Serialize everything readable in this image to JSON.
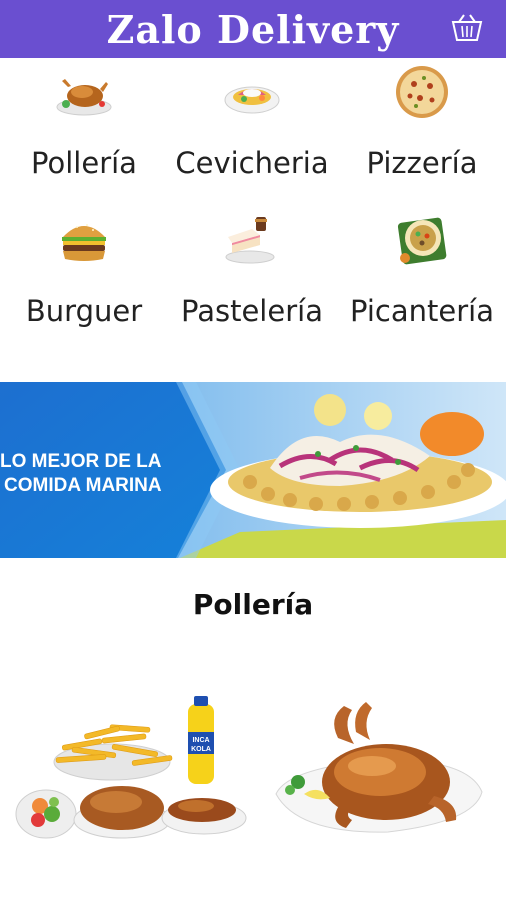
{
  "header": {
    "title": "Zalo Delivery",
    "cart_icon": "cart-icon",
    "color": "#6a4fd0"
  },
  "categories": [
    {
      "label": "Pollería",
      "icon": "roast-chicken-icon"
    },
    {
      "label": "Cevicheria",
      "icon": "ceviche-plate-icon"
    },
    {
      "label": "Pizzería",
      "icon": "pizza-icon"
    },
    {
      "label": "Burguer",
      "icon": "burger-icon"
    },
    {
      "label": "Pastelería",
      "icon": "cake-icon"
    },
    {
      "label": "Picantería",
      "icon": "spicy-dish-icon"
    }
  ],
  "banner": {
    "line1": "LO MEJOR DE LA",
    "line2": "COMIDA MARINA",
    "color": "#1f7fd8"
  },
  "section": {
    "title": "Pollería"
  },
  "products": [
    {
      "image": "chicken-combo-fries-soda-image",
      "soda_label_1": "INCA",
      "soda_label_2": "KOLA"
    },
    {
      "image": "whole-roast-chicken-image"
    }
  ]
}
